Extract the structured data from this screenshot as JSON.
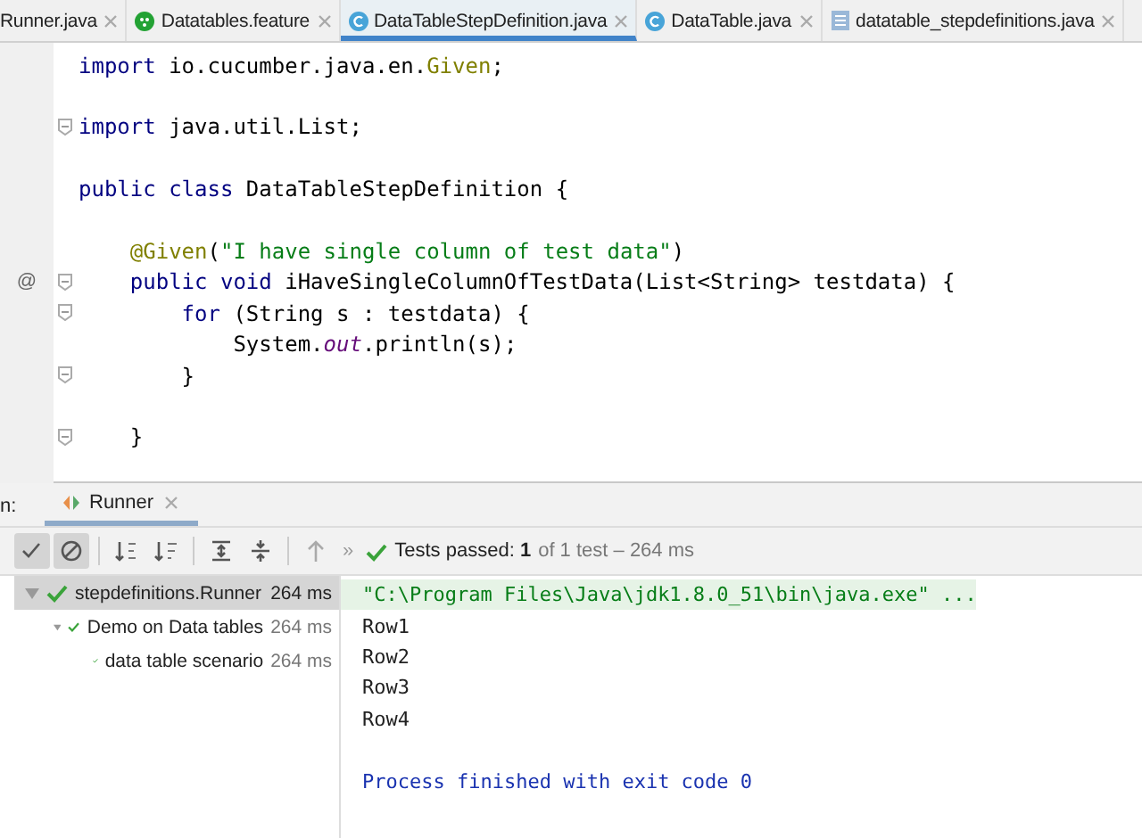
{
  "tabs": [
    {
      "label": "Runner.java",
      "kind": "plain",
      "selected": false
    },
    {
      "label": "Datatables.feature",
      "kind": "feature",
      "selected": false
    },
    {
      "label": "DataTableStepDefinition.java",
      "kind": "class",
      "selected": true
    },
    {
      "label": "DataTable.java",
      "kind": "class",
      "selected": false
    },
    {
      "label": "datatable_stepdefinitions.java",
      "kind": "file",
      "selected": false
    }
  ],
  "code": {
    "lines": [
      {
        "fold": false,
        "segments": [
          {
            "kind": "keyword",
            "text": "import "
          },
          {
            "kind": "plain",
            "text": "io.cucumber.java.en."
          },
          {
            "kind": "annotation",
            "text": "Given"
          },
          {
            "kind": "plain",
            "text": ";"
          }
        ]
      },
      {
        "fold": false
      },
      {
        "fold": true,
        "segments": [
          {
            "kind": "keyword",
            "text": "import "
          },
          {
            "kind": "plain",
            "text": "java.util.List;"
          }
        ]
      },
      {
        "fold": false
      },
      {
        "fold": false,
        "segments": [
          {
            "kind": "keyword",
            "text": "public class "
          },
          {
            "kind": "plain",
            "text": "DataTableStepDefinition {"
          }
        ]
      },
      {
        "fold": false
      },
      {
        "fold": false,
        "segments": [
          {
            "kind": "annotation",
            "text": "    @Given"
          },
          {
            "kind": "plain",
            "text": "("
          },
          {
            "kind": "string",
            "text": "\"I have single column of test data\""
          },
          {
            "kind": "plain",
            "text": ")"
          }
        ]
      },
      {
        "fold": true,
        "gutter": "@",
        "segments": [
          {
            "kind": "keyword",
            "text": "    public void "
          },
          {
            "kind": "plain",
            "text": "iHaveSingleColumnOfTestData(List<String> testdata) {"
          }
        ]
      },
      {
        "fold": true,
        "segments": [
          {
            "kind": "keyword",
            "text": "        for "
          },
          {
            "kind": "plain",
            "text": "(String s : testdata) {"
          }
        ]
      },
      {
        "fold": false,
        "segments": [
          {
            "kind": "plain",
            "text": "            System."
          },
          {
            "kind": "field",
            "text": "out"
          },
          {
            "kind": "plain",
            "text": ".println(s);"
          }
        ]
      },
      {
        "fold": true,
        "segments": [
          {
            "kind": "plain",
            "text": "        }"
          }
        ]
      },
      {
        "fold": false
      },
      {
        "fold": true,
        "segments": [
          {
            "kind": "plain",
            "text": "    }"
          }
        ]
      },
      {
        "fold": false
      }
    ]
  },
  "run_panel": {
    "label": "n:",
    "tab": "Runner",
    "toolbar": [
      {
        "kind": "check",
        "selected": true
      },
      {
        "kind": "cancel",
        "selected": true
      },
      {
        "kind": "sort-alpha",
        "selected": false
      },
      {
        "kind": "sort-duration",
        "selected": false
      },
      {
        "kind": "expand",
        "selected": false
      },
      {
        "kind": "collapse",
        "selected": false
      },
      {
        "kind": "up",
        "selected": false
      }
    ],
    "more": "»",
    "status": "Tests passed: **1**",
    "status_detail": "of 1 test – 264 ms",
    "tree": [
      {
        "name": "stepdefinitions.Runner",
        "time": "264 ms",
        "expanded": true,
        "selected": true,
        "children": [
          {
            "name": "Demo on Data tables",
            "time": "264 ms",
            "expanded": true,
            "selected": false,
            "children": [
              {
                "name": "data table scenario",
                "time": "264 ms",
                "selected": false
              }
            ]
          }
        ]
      }
    ],
    "console": [
      {
        "kind": "command",
        "text": "\"C:\\Program Files\\Java\\jdk1.8.0_51\\bin\\java.exe\" ..."
      },
      {
        "kind": "output",
        "text": "Row1"
      },
      {
        "kind": "output",
        "text": "Row2"
      },
      {
        "kind": "output",
        "text": "Row3"
      },
      {
        "kind": "output",
        "text": "Row4"
      },
      {
        "kind": "blank"
      },
      {
        "kind": "info",
        "text": "Process finished with exit code 0"
      }
    ]
  }
}
